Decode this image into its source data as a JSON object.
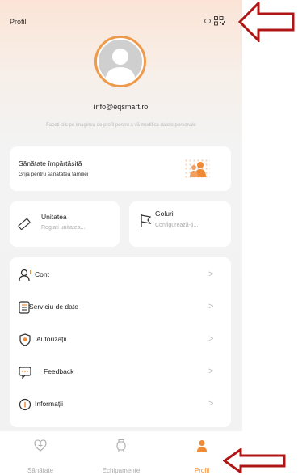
{
  "header": {
    "title": "Profil"
  },
  "profile": {
    "email": "info@eqsmart.ro",
    "hint": "Faceți clic pe imaginea de profil pentru a vă modifica datele personale"
  },
  "shared_health": {
    "title": "Sănătate împărtășită",
    "subtitle": "Grija pentru sănătatea familiei"
  },
  "unit_card": {
    "title": "Unitatea",
    "subtitle": "Reglați unitatea..."
  },
  "goals_card": {
    "title": "Goluri",
    "subtitle": "Configurează-ți..."
  },
  "menu": [
    {
      "label": "Cont",
      "icon": "account-icon"
    },
    {
      "label": "Serviciu de date",
      "icon": "data-service-icon"
    },
    {
      "label": "Autorizații",
      "icon": "shield-icon"
    },
    {
      "label": "Feedback",
      "icon": "feedback-icon"
    },
    {
      "label": "Informații",
      "icon": "info-icon"
    }
  ],
  "tabbar": {
    "tabs": [
      {
        "label": "Sănătate",
        "icon": "heart-plus-icon",
        "active": false
      },
      {
        "label": "Echipamente",
        "icon": "watch-icon",
        "active": false
      },
      {
        "label": "Profil",
        "icon": "person-icon",
        "active": true
      }
    ]
  },
  "colors": {
    "accent": "#ef8a35",
    "arrow": "#b01515"
  }
}
